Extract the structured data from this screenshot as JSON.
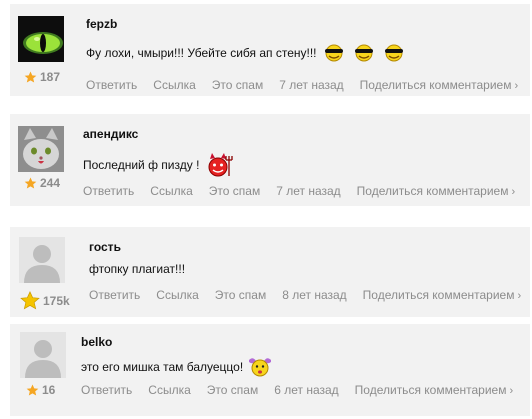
{
  "actions": {
    "reply": "Ответить",
    "link": "Ссылка",
    "spam": "Это спам",
    "share": "Поделиться комментарием"
  },
  "comments": [
    {
      "author": "fepzb",
      "text": "Фу лохи, чмыри!!! Убейте сибя ап стену!!!",
      "rating": "187",
      "time": "7 лет назад",
      "avatar": "cat-eye-avatar"
    },
    {
      "author": "апендикс",
      "text": "Последний ф пизду !",
      "rating": "244",
      "time": "7 лет назад",
      "avatar": "grey-cat-avatar"
    },
    {
      "author": "гость",
      "text": "фтопку плагиат!!!",
      "rating": "175k",
      "time": "8 лет назад",
      "avatar": "default-user-avatar"
    },
    {
      "author": "belko",
      "text": "это его мишка там балуеццо!",
      "rating": "16",
      "time": "6 лет назад",
      "avatar": "default-user-avatar"
    }
  ],
  "colors": {
    "panel": "#f2f2f2",
    "muted": "#8c8c8c",
    "star": "#f5a623"
  }
}
